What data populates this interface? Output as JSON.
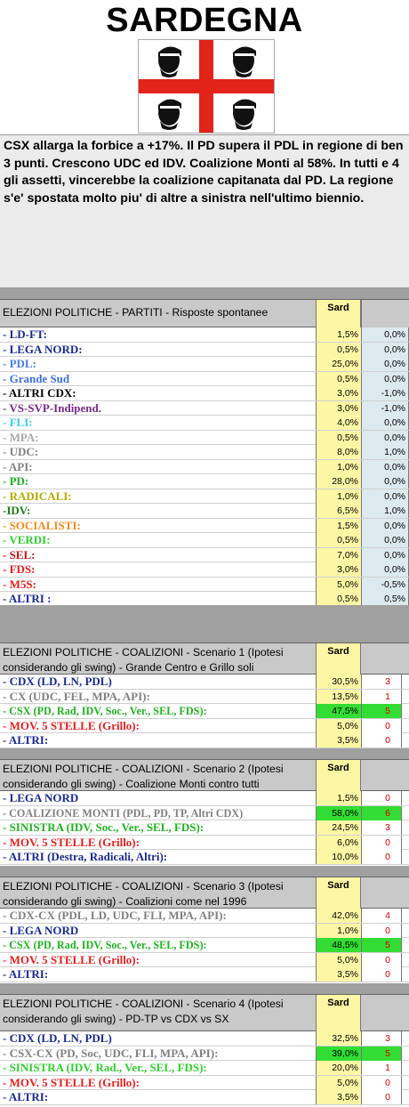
{
  "title": "SARDEGNA",
  "intro": "CSX allarga la forbice a +17%. Il PD supera il PDL in regione di ben 3 punti. Crescono UDC ed IDV.  Coalizione Monti al 58%. In tutti e 4 gli assetti, vincerebbe la coalizione capitanata dal PD. La regione s'e' spostata molto piu' di altre a sinistra nell'ultimo biennio.",
  "colors": {
    "header_bg": "#c9c9c9",
    "sard_col_bg": "#fdf7a5",
    "diff_col_bg": "#dce9ef",
    "winner_bg": "#33dd33",
    "seat_text": "#cc0000",
    "flag_cross": "#e2231a"
  },
  "flag": {
    "icon": "four-moors-flag"
  },
  "sections": [
    {
      "header": "ELEZIONI POLITICHE - PARTITI - Risposte spontanee",
      "col_label": "Sard",
      "rows": [
        {
          "label": "- LD-FT:",
          "color": "#1a2a8c",
          "value": "1,5%",
          "extra": "0,0%"
        },
        {
          "label": "- LEGA NORD:",
          "color": "#1a2a8c",
          "value": "0,5%",
          "extra": "0,0%"
        },
        {
          "label": "- PDL:",
          "color": "#4a7be0",
          "value": "25,0%",
          "extra": "0,0%"
        },
        {
          "label": "- Grande Sud",
          "color": "#3a6fd8",
          "value": "0,5%",
          "extra": "0,0%"
        },
        {
          "label": "- ALTRI CDX:",
          "color": "#000000",
          "value": "3,0%",
          "extra": "-1,0%"
        },
        {
          "label": "- VS-SVP-Indipend.",
          "color": "#7a2a8a",
          "value": "3,0%",
          "extra": "-1,0%"
        },
        {
          "label": "- FLI:",
          "color": "#3fd0e0",
          "value": "4,0%",
          "extra": "0,0%"
        },
        {
          "label": "- MPA:",
          "color": "#a8a8a8",
          "value": "0,5%",
          "extra": "0,0%"
        },
        {
          "label": "- UDC:",
          "color": "#808080",
          "value": "8,0%",
          "extra": "1,0%"
        },
        {
          "label": "- API:",
          "color": "#808080",
          "value": "1,0%",
          "extra": "0,0%"
        },
        {
          "label": "- PD:",
          "color": "#22b022",
          "value": "28,0%",
          "extra": "0,0%"
        },
        {
          "label": "- RADICALI:",
          "color": "#b8a800",
          "value": "1,0%",
          "extra": "0,0%"
        },
        {
          "label": "-IDV:",
          "color": "#1a7a1a",
          "value": "6,5%",
          "extra": "1,0%"
        },
        {
          "label": "- SOCIALISTI:",
          "color": "#f08a20",
          "value": "1,5%",
          "extra": "0,0%"
        },
        {
          "label": "- VERDI:",
          "color": "#33cc33",
          "value": "0,5%",
          "extra": "0,0%"
        },
        {
          "label": "- SEL:",
          "color": "#c01818",
          "value": "7,0%",
          "extra": "0,0%"
        },
        {
          "label": "- FDS:",
          "color": "#e02020",
          "value": "3,0%",
          "extra": "0,0%"
        },
        {
          "label": "- M5S:",
          "color": "#e02020",
          "value": "5,0%",
          "extra": "-0,5%"
        },
        {
          "label": "- ALTRI :",
          "color": "#1a2a8c",
          "value": "0,5%",
          "extra": "0,5%"
        }
      ]
    },
    {
      "header": "ELEZIONI POLITICHE - COALIZIONI - Scenario 1 (Ipotesi considerando gli swing) - Grande Centro e Grillo soli",
      "col_label": "Sard",
      "rows": [
        {
          "label": "- CDX (LD, LN, PDL)",
          "color": "#1a2a8c",
          "value": "30,5%",
          "extra": "3",
          "winner": false
        },
        {
          "label": "- CX (UDC, FEL, MPA, API):",
          "color": "#808080",
          "value": "13,5%",
          "extra": "1",
          "winner": false
        },
        {
          "label": "- CSX (PD, Rad, IDV, Soc., Ver., SEL, FDS):",
          "color": "#22b022",
          "value": "47,5%",
          "extra": "5",
          "winner": true
        },
        {
          "label": "- MOV. 5 STELLE (Grillo):",
          "color": "#e02020",
          "value": "5,0%",
          "extra": "0",
          "winner": false
        },
        {
          "label": "- ALTRI:",
          "color": "#1a2a8c",
          "value": "3,5%",
          "extra": "0",
          "winner": false
        }
      ]
    },
    {
      "header": "ELEZIONI POLITICHE - COALIZIONI - Scenario 2 (Ipotesi considerando gli swing) - Coalizione Monti contro tutti",
      "col_label": "Sard",
      "rows": [
        {
          "label": "- LEGA NORD",
          "color": "#1a2a8c",
          "value": "1,5%",
          "extra": "0",
          "winner": false
        },
        {
          "label": "- COALIZIONE MONTI (PDL, PD, TP, Altri CDX)",
          "color": "#808080",
          "value": "58,0%",
          "extra": "6",
          "winner": true
        },
        {
          "label": "- SINISTRA (IDV, Soc., Ver., SEL, FDS):",
          "color": "#22b022",
          "value": "24,5%",
          "extra": "3",
          "winner": false
        },
        {
          "label": "- MOV. 5 STELLE (Grillo):",
          "color": "#e02020",
          "value": "6,0%",
          "extra": "0",
          "winner": false
        },
        {
          "label": "- ALTRI (Destra, Radicali, Altri):",
          "color": "#1a2a8c",
          "value": "10,0%",
          "extra": "0",
          "winner": false
        }
      ]
    },
    {
      "header": "ELEZIONI POLITICHE - COALIZIONI - Scenario 3 (Ipotesi considerando gli swing) - Coalizioni come nel 1996",
      "col_label": "Sard",
      "rows": [
        {
          "label": "- CDX-CX (PDL, LD, UDC, FLI, MPA, API):",
          "color": "#808080",
          "value": "42,0%",
          "extra": "4",
          "winner": false
        },
        {
          "label": "- LEGA NORD",
          "color": "#1a2a8c",
          "value": "1,0%",
          "extra": "0",
          "winner": false
        },
        {
          "label": "- CSX (PD, Rad, IDV, Soc., Ver., SEL, FDS):",
          "color": "#22b022",
          "value": "48,5%",
          "extra": "5",
          "winner": true
        },
        {
          "label": "- MOV. 5 STELLE (Grillo):",
          "color": "#e02020",
          "value": "5,0%",
          "extra": "0",
          "winner": false
        },
        {
          "label": "- ALTRI:",
          "color": "#1a2a8c",
          "value": "3,5%",
          "extra": "0",
          "winner": false
        }
      ]
    },
    {
      "header": "ELEZIONI POLITICHE - COALIZIONI - Scenario 4 (Ipotesi considerando gli swing) - PD-TP  vs  CDX  vs SX",
      "col_label": "Sard",
      "rows": [
        {
          "label": "- CDX (LD, LN, PDL)",
          "color": "#1a2a8c",
          "value": "32,5%",
          "extra": "3",
          "winner": false
        },
        {
          "label": "- CSX-CX (PD, Soc, UDC, FLI, MPA, API):",
          "color": "#808080",
          "value": "39,0%",
          "extra": "5",
          "winner": true
        },
        {
          "label": "- SINISTRA (IDV, Rad., Ver., SEL, FDS):",
          "color": "#33cc33",
          "value": "20,0%",
          "extra": "1",
          "winner": false
        },
        {
          "label": "- MOV. 5 STELLE (Grillo):",
          "color": "#e02020",
          "value": "5,0%",
          "extra": "0",
          "winner": false
        },
        {
          "label": "- ALTRI:",
          "color": "#1a2a8c",
          "value": "3,5%",
          "extra": "0",
          "winner": false
        }
      ]
    }
  ]
}
